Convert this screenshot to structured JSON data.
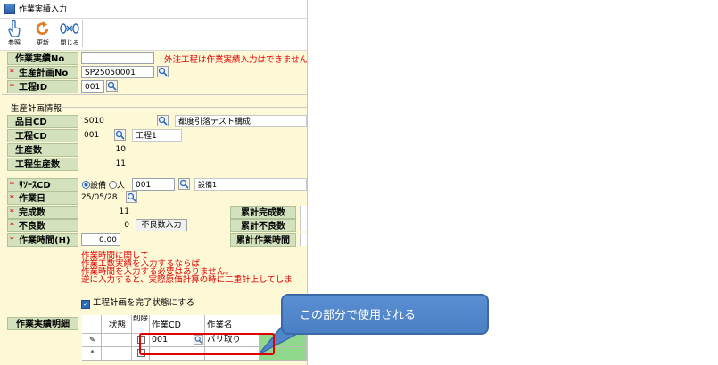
{
  "window": {
    "title": "作業実績入力"
  },
  "toolbar": {
    "buttons": [
      {
        "label": "参照"
      },
      {
        "label": "更新"
      },
      {
        "label": "閉じる"
      }
    ]
  },
  "header": {
    "record_no": {
      "label": "作業実績No",
      "value": ""
    },
    "notice": "外注工程は作業実績入力はできません。",
    "plan_no": {
      "label": "生産計画No",
      "value": "SP25050001"
    },
    "process_id": {
      "label": "工程ID",
      "value": "001"
    }
  },
  "plan_info": {
    "section_title": "生産計画情報",
    "item_cd": {
      "label": "品目CD",
      "value": "S010",
      "name": "都度引落テスト構成"
    },
    "process_cd": {
      "label": "工程CD",
      "value": "001",
      "name": "工程1"
    },
    "production_qty": {
      "label": "生産数",
      "value": "10"
    },
    "process_qty": {
      "label": "工程生産数",
      "value": "11"
    }
  },
  "entry": {
    "resource_cd": {
      "label": "ﾘｿｰｽCD",
      "radio_equipment": "設備",
      "radio_person": "人",
      "value": "001",
      "name": "設備1"
    },
    "work_date": {
      "label": "作業日",
      "value": "25/05/28"
    },
    "completed_qty": {
      "label": "完成数",
      "value": "11"
    },
    "defect_qty": {
      "label": "不良数",
      "value": "0",
      "button": "不良数入力"
    },
    "work_hours": {
      "label": "作業時間(H)",
      "value": "0.00"
    },
    "totals": {
      "completed": "累計完成数",
      "defect": "累計不良数",
      "hours": "累計作業時間"
    },
    "notes": [
      "作業時間に関して",
      "作業工数実績を入力するならば",
      "作業時間を入力する必要はありません。",
      "逆に入力すると、実際原価計算の時に二重計上してしま"
    ],
    "complete_checkbox": {
      "label": "工程計画を完了状態にする",
      "checked": true
    }
  },
  "details": {
    "label": "作業実績明細",
    "columns": [
      "状態",
      "削除",
      "作業CD",
      "作業名"
    ],
    "rows": [
      {
        "marker": "✎",
        "status": "",
        "work_cd": "001",
        "work_name": "バリ取り"
      },
      {
        "marker": "*",
        "status": "",
        "work_cd": "",
        "work_name": ""
      }
    ]
  },
  "callout": {
    "text": "この部分で使用される"
  },
  "colors": {
    "label_bg": "#d3e2bd",
    "panel_bg": "#fdf9d7",
    "required": "#d00000",
    "notice": "#e00000",
    "callout_bg": "#4f86cb",
    "highlight": "#e00000",
    "grid_fill": "#90d98c"
  }
}
